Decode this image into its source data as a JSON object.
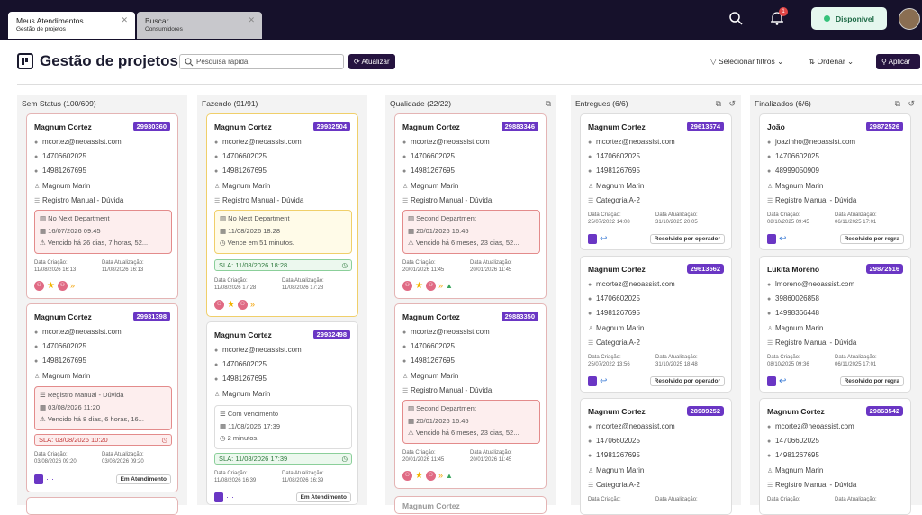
{
  "tabs": [
    {
      "title": "Meus Atendimentos",
      "sub": "Gestão de projetos"
    },
    {
      "title": "Buscar",
      "sub": "Consumidores"
    }
  ],
  "topbar": {
    "status": "Disponível",
    "notif_count": "1"
  },
  "page": {
    "title": "Gestão de projetos",
    "search_placeholder": "Pesquisa rápida",
    "refresh": "Atualizar",
    "filters": "Selecionar filtros",
    "order": "Ordenar",
    "apply": "Aplicar"
  },
  "columns": [
    {
      "title": "Sem Status (100/609)"
    },
    {
      "title": "Fazendo (91/91)"
    },
    {
      "title": "Qualidade (22/22)"
    },
    {
      "title": "Entregues (6/6)"
    },
    {
      "title": "Finalizados (6/6)"
    }
  ],
  "labels": {
    "created": "Data Criação:",
    "updated": "Data Atualização:"
  },
  "cards": {
    "c1": {
      "name": "Magnum Cortez",
      "id": "29930360",
      "email": "mcortez@neoassist.com",
      "phone1": "14706602025",
      "phone2": "14981267695",
      "agent": "Magnum Marin",
      "channel": "Registro Manual - Dúvida",
      "b1": "No Next Department",
      "b2": "16/07/2026 09:45",
      "b3": "Vencido há 26 dias, 7 horas, 52...",
      "created": "11/08/2026 16:13",
      "updated": "11/08/2026 16:13"
    },
    "c2": {
      "name": "Magnum Cortez",
      "id": "29931398",
      "email": "mcortez@neoassist.com",
      "phone1": "14706602025",
      "phone2": "14981267695",
      "agent": "Magnum Marin",
      "b1": "Registro Manual - Dúvida",
      "b2": "03/08/2026 11:20",
      "b3": "Vencido há 8 dias, 6 horas, 16...",
      "sla": "SLA: 03/08/2026 10:20",
      "created": "03/08/2026 09:20",
      "updated": "03/08/2026 09:20",
      "badge": "Em Atendimento"
    },
    "c3": {
      "name": "Magnum Cortez",
      "id": "29932504",
      "email": "mcortez@neoassist.com",
      "phone1": "14706602025",
      "phone2": "14981267695",
      "agent": "Magnum Marin",
      "channel": "Registro Manual - Dúvida",
      "b1": "No Next Department",
      "b2": "11/08/2026 18:28",
      "b3": "Vence em 51 minutos.",
      "sla": "SLA: 11/08/2026 18:28",
      "created": "11/08/2026 17:28",
      "updated": "11/08/2026 17:28"
    },
    "c4": {
      "name": "Magnum Cortez",
      "id": "29932498",
      "email": "mcortez@neoassist.com",
      "phone1": "14706602025",
      "phone2": "14981267695",
      "agent": "Magnum Marin",
      "b1": "Com vencimento",
      "b2": "11/08/2026 17:39",
      "b3": "2 minutos.",
      "sla": "SLA: 11/08/2026 17:39",
      "created": "11/08/2026 16:39",
      "updated": "11/08/2026 16:39",
      "badge": "Em Atendimento"
    },
    "c5": {
      "name": "Magnum Cortez",
      "id": "29883346",
      "email": "mcortez@neoassist.com",
      "phone1": "14706602025",
      "phone2": "14981267695",
      "agent": "Magnum Marin",
      "channel": "Registro Manual - Dúvida",
      "b1": "Second Department",
      "b2": "20/01/2026 16:45",
      "b3": "Vencido há 6 meses, 23 dias, 52...",
      "created": "20/01/2026 11:45",
      "updated": "20/01/2026 11:45"
    },
    "c6": {
      "name": "Magnum Cortez",
      "id": "29883350",
      "email": "mcortez@neoassist.com",
      "phone1": "14706602025",
      "phone2": "14981267695",
      "agent": "Magnum Marin",
      "channel": "Registro Manual - Dúvida",
      "b1": "Second Department",
      "b2": "20/01/2026 16:45",
      "b3": "Vencido há 6 meses, 23 dias, 52...",
      "created": "20/01/2026 11:45",
      "updated": "20/01/2026 11:45",
      "next": "Magnum Cortez"
    },
    "c7": {
      "name": "Magnum Cortez",
      "id": "29613574",
      "email": "mcortez@neoassist.com",
      "phone1": "14706602025",
      "phone2": "14981267695",
      "agent": "Magnum Marin",
      "channel": "Categoria A-2",
      "created": "25/07/2022 14:08",
      "updated": "31/10/2025 20:05",
      "badge": "Resolvido por operador"
    },
    "c8": {
      "name": "Magnum Cortez",
      "id": "29613562",
      "email": "mcortez@neoassist.com",
      "phone1": "14706602025",
      "phone2": "14981267695",
      "agent": "Magnum Marin",
      "channel": "Categoria A-2",
      "created": "25/07/2022 13:56",
      "updated": "31/10/2025 18:48",
      "badge": "Resolvido por operador"
    },
    "c9": {
      "name": "Magnum Cortez",
      "id": "28989252",
      "email": "mcortez@neoassist.com",
      "phone1": "14706602025",
      "phone2": "14981267695",
      "agent": "Magnum Marin",
      "channel": "Categoria A-2"
    },
    "c10": {
      "name": "João",
      "id": "29872526",
      "email": "joazinho@neoassist.com",
      "phone1": "14706602025",
      "phone2": "48999050909",
      "agent": "Magnum Marin",
      "channel": "Registro Manual - Dúvida",
      "created": "08/10/2025 09:45",
      "updated": "06/11/2025 17:01",
      "badge": "Resolvido por regra"
    },
    "c11": {
      "name": "Lukita Moreno",
      "id": "29872516",
      "email": "lmoreno@neoassist.com",
      "phone1": "39860026858",
      "phone2": "14998366448",
      "agent": "Magnum Marin",
      "channel": "Registro Manual - Dúvida",
      "created": "08/10/2025 09:36",
      "updated": "06/11/2025 17:01",
      "badge": "Resolvido por regra"
    },
    "c12": {
      "name": "Magnum Cortez",
      "id": "29863542",
      "email": "mcortez@neoassist.com",
      "phone1": "14706602025",
      "phone2": "14981267695",
      "agent": "Magnum Marin",
      "channel": "Registro Manual - Dúvida"
    }
  }
}
